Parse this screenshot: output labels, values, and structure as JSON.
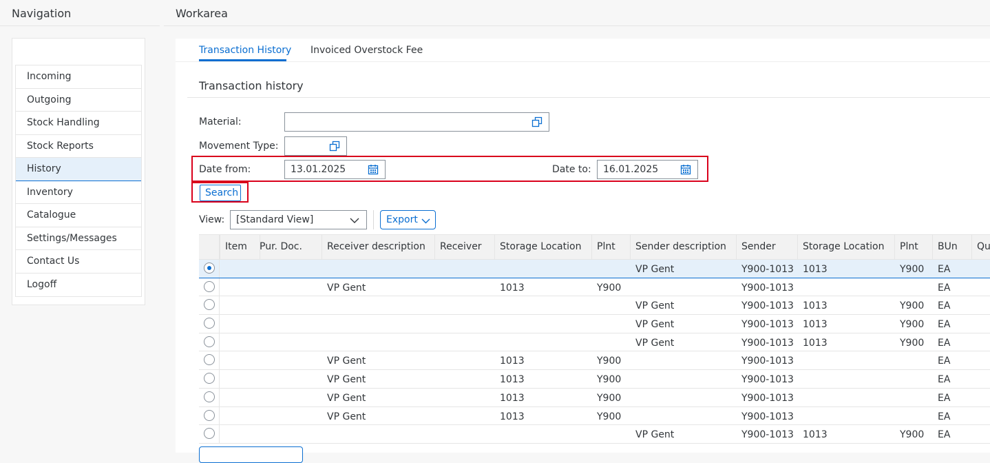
{
  "navigation": {
    "title": "Navigation",
    "items": [
      {
        "label": "Incoming"
      },
      {
        "label": "Outgoing"
      },
      {
        "label": "Stock Handling"
      },
      {
        "label": "Stock Reports"
      },
      {
        "label": "History",
        "active": true
      },
      {
        "label": "Inventory"
      },
      {
        "label": "Catalogue"
      },
      {
        "label": "Settings/Messages"
      },
      {
        "label": "Contact Us"
      },
      {
        "label": "Logoff"
      }
    ]
  },
  "workarea": {
    "title": "Workarea",
    "tabs": [
      {
        "label": "Transaction History",
        "active": true
      },
      {
        "label": "Invoiced Overstock Fee"
      }
    ],
    "section_title": "Transaction history",
    "form": {
      "material_label": "Material:",
      "material_value": "",
      "movement_type_label": "Movement Type:",
      "movement_type_value": "",
      "date_from_label": "Date from:",
      "date_from_value": "13.01.2025",
      "date_to_label": "Date to:",
      "date_to_value": "16.01.2025",
      "search_label": "Search"
    },
    "view": {
      "label": "View:",
      "selected": "[Standard View]",
      "export_label": "Export"
    },
    "table": {
      "columns": [
        "Item",
        "Pur. Doc.",
        "Receiver description",
        "Receiver",
        "Storage Location",
        "Plnt",
        "Sender description",
        "Sender",
        "Storage Location",
        "Plnt",
        "BUn",
        "Qu"
      ],
      "rows": [
        {
          "selected": true,
          "cells": [
            "",
            "",
            "",
            "",
            "",
            "",
            "VP Gent",
            "Y900-1013",
            "1013",
            "Y900",
            "EA",
            ""
          ]
        },
        {
          "selected": false,
          "cells": [
            "",
            "",
            "VP Gent",
            "",
            "1013",
            "Y900",
            "",
            "Y900-1013",
            "",
            "",
            "EA",
            ""
          ]
        },
        {
          "selected": false,
          "cells": [
            "",
            "",
            "",
            "",
            "",
            "",
            "VP Gent",
            "Y900-1013",
            "1013",
            "Y900",
            "EA",
            ""
          ]
        },
        {
          "selected": false,
          "cells": [
            "",
            "",
            "",
            "",
            "",
            "",
            "VP Gent",
            "Y900-1013",
            "1013",
            "Y900",
            "EA",
            ""
          ]
        },
        {
          "selected": false,
          "cells": [
            "",
            "",
            "",
            "",
            "",
            "",
            "VP Gent",
            "Y900-1013",
            "1013",
            "Y900",
            "EA",
            ""
          ]
        },
        {
          "selected": false,
          "cells": [
            "",
            "",
            "VP Gent",
            "",
            "1013",
            "Y900",
            "",
            "Y900-1013",
            "",
            "",
            "EA",
            ""
          ]
        },
        {
          "selected": false,
          "cells": [
            "",
            "",
            "VP Gent",
            "",
            "1013",
            "Y900",
            "",
            "Y900-1013",
            "",
            "",
            "EA",
            ""
          ]
        },
        {
          "selected": false,
          "cells": [
            "",
            "",
            "VP Gent",
            "",
            "1013",
            "Y900",
            "",
            "Y900-1013",
            "",
            "",
            "EA",
            ""
          ]
        },
        {
          "selected": false,
          "cells": [
            "",
            "",
            "VP Gent",
            "",
            "1013",
            "Y900",
            "",
            "Y900-1013",
            "",
            "",
            "EA",
            ""
          ]
        },
        {
          "selected": false,
          "cells": [
            "",
            "",
            "",
            "",
            "",
            "",
            "VP Gent",
            "Y900-1013",
            "1013",
            "Y900",
            "EA",
            ""
          ]
        }
      ]
    }
  },
  "colors": {
    "accent": "#0a6ed1",
    "highlight": "#d9001b",
    "selected_row": "#e5f0fa"
  },
  "icons": {
    "value_help": "value-help-icon",
    "calendar": "calendar-icon",
    "chevron": "chevron-down-icon"
  }
}
